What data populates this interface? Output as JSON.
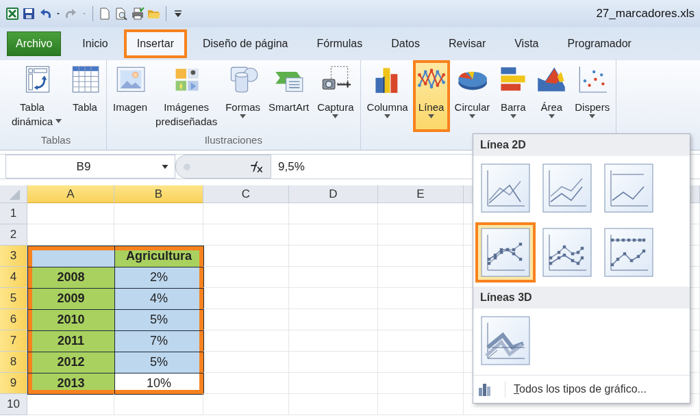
{
  "quick_access": [
    {
      "kind": "excel"
    },
    {
      "kind": "save"
    },
    {
      "kind": "undo"
    },
    {
      "kind": "caret"
    },
    {
      "kind": "redo",
      "disabled": true
    },
    {
      "kind": "caret",
      "disabled": true
    },
    {
      "kind": "new"
    },
    {
      "kind": "preview"
    },
    {
      "kind": "print"
    },
    {
      "kind": "open"
    },
    {
      "kind": "customize"
    }
  ],
  "window": {
    "title": "27_marcadores.xls"
  },
  "tabs": [
    {
      "label": "Archivo",
      "kind": "file",
      "selected": false,
      "annotated": false
    },
    {
      "label": "Inicio",
      "kind": "tab",
      "selected": false,
      "annotated": false
    },
    {
      "label": "Insertar",
      "kind": "tab",
      "selected": true,
      "annotated": true
    },
    {
      "label": "Diseño de página",
      "kind": "tab",
      "selected": false,
      "annotated": false
    },
    {
      "label": "Fórmulas",
      "kind": "tab",
      "selected": false,
      "annotated": false
    },
    {
      "label": "Datos",
      "kind": "tab",
      "selected": false,
      "annotated": false
    },
    {
      "label": "Revisar",
      "kind": "tab",
      "selected": false,
      "annotated": false
    },
    {
      "label": "Vista",
      "kind": "tab",
      "selected": false,
      "annotated": false
    },
    {
      "label": "Programador",
      "kind": "tab",
      "selected": false,
      "annotated": false
    }
  ],
  "ribbon_groups": [
    {
      "label": "Tablas",
      "buttons": [
        {
          "kind": "pivot",
          "label": "Tabla\ndinámica",
          "dropdown": true,
          "pressed": false,
          "annotated": false
        },
        {
          "kind": "table",
          "label": "Tabla",
          "dropdown": false,
          "pressed": false,
          "annotated": false
        }
      ]
    },
    {
      "label": "Ilustraciones",
      "buttons": [
        {
          "kind": "picture",
          "label": "Imagen",
          "dropdown": false,
          "pressed": false,
          "annotated": false
        },
        {
          "kind": "clipart",
          "label": "Imágenes\nprediseñadas",
          "dropdown": false,
          "pressed": false,
          "annotated": false
        },
        {
          "kind": "shapes",
          "label": "Formas",
          "dropdown": true,
          "pressed": false,
          "annotated": false
        },
        {
          "kind": "smartart",
          "label": "SmartArt",
          "dropdown": false,
          "pressed": false,
          "annotated": false
        },
        {
          "kind": "screenshot",
          "label": "Captura",
          "dropdown": true,
          "pressed": false,
          "annotated": false
        }
      ]
    },
    {
      "buttons": [
        {
          "kind": "column",
          "label": "Columna",
          "dropdown": true,
          "pressed": false,
          "annotated": false
        },
        {
          "kind": "line",
          "label": "Línea",
          "dropdown": true,
          "pressed": true,
          "annotated": true
        },
        {
          "kind": "pie",
          "label": "Circular",
          "dropdown": true,
          "pressed": false,
          "annotated": false
        },
        {
          "kind": "bar",
          "label": "Barra",
          "dropdown": true,
          "pressed": false,
          "annotated": false
        },
        {
          "kind": "area",
          "label": "Área",
          "dropdown": true,
          "pressed": false,
          "annotated": false
        },
        {
          "kind": "scatter",
          "label": "Dispers",
          "dropdown": true,
          "pressed": false,
          "annotated": false
        }
      ]
    }
  ],
  "formula_bar": {
    "name_box": "B9",
    "value": "9,5%"
  },
  "sheet": {
    "annotated": true,
    "columns": [
      {
        "label": "A",
        "selected": true
      },
      {
        "label": "B",
        "selected": true
      },
      {
        "label": "C",
        "selected": false
      },
      {
        "label": "D",
        "selected": false
      },
      {
        "label": "E",
        "selected": false
      }
    ],
    "rows": [
      {
        "label": "1",
        "selected": false
      },
      {
        "label": "2",
        "selected": false
      },
      {
        "label": "3",
        "selected": true,
        "cells": [
          {
            "color": "#bdd7ee",
            "kind": "value"
          },
          {
            "text": "Agricultura",
            "color": "#a9d15f",
            "kind": "heading"
          }
        ]
      },
      {
        "label": "4",
        "selected": true,
        "cells": [
          {
            "text": "2008",
            "color": "#a9d15f",
            "kind": "heading"
          },
          {
            "text": "2%",
            "color": "#bdd7ee",
            "kind": "value"
          }
        ]
      },
      {
        "label": "5",
        "selected": true,
        "cells": [
          {
            "text": "2009",
            "color": "#a9d15f",
            "kind": "heading"
          },
          {
            "text": "4%",
            "color": "#bdd7ee",
            "kind": "value"
          }
        ]
      },
      {
        "label": "6",
        "selected": true,
        "cells": [
          {
            "text": "2010",
            "color": "#a9d15f",
            "kind": "heading"
          },
          {
            "text": "5%",
            "color": "#bdd7ee",
            "kind": "value"
          }
        ]
      },
      {
        "label": "7",
        "selected": true,
        "cells": [
          {
            "text": "2011",
            "color": "#a9d15f",
            "kind": "heading"
          },
          {
            "text": "7%",
            "color": "#bdd7ee",
            "kind": "value"
          }
        ]
      },
      {
        "label": "8",
        "selected": true,
        "cells": [
          {
            "text": "2012",
            "color": "#a9d15f",
            "kind": "heading"
          },
          {
            "text": "5%",
            "color": "#bdd7ee",
            "kind": "value"
          }
        ]
      },
      {
        "label": "9",
        "selected": true,
        "cells": [
          {
            "text": "2013",
            "color": "#a9d15f",
            "kind": "heading"
          },
          {
            "text": "10%",
            "color": "#ffffff",
            "kind": "value"
          }
        ]
      },
      {
        "label": "10",
        "selected": false
      }
    ]
  },
  "chart_menu": {
    "sections": [
      {
        "title": "Línea 2D",
        "options": [
          {
            "kind": "line",
            "selected": false,
            "annotated": false
          },
          {
            "kind": "stacked",
            "selected": false,
            "annotated": false
          },
          {
            "kind": "percent",
            "selected": false,
            "annotated": false
          },
          {
            "kind": "line_markers",
            "selected": true,
            "annotated": true
          },
          {
            "kind": "stacked_markers",
            "selected": false,
            "annotated": false
          },
          {
            "kind": "percent_markers",
            "selected": false,
            "annotated": false
          }
        ]
      },
      {
        "title": "Líneas 3D",
        "options": [
          {
            "kind": "line_3d",
            "selected": false,
            "annotated": false
          }
        ]
      }
    ],
    "footer": {
      "label": "Todos los tipos de gráfico...",
      "access_key_underlined": true
    }
  }
}
